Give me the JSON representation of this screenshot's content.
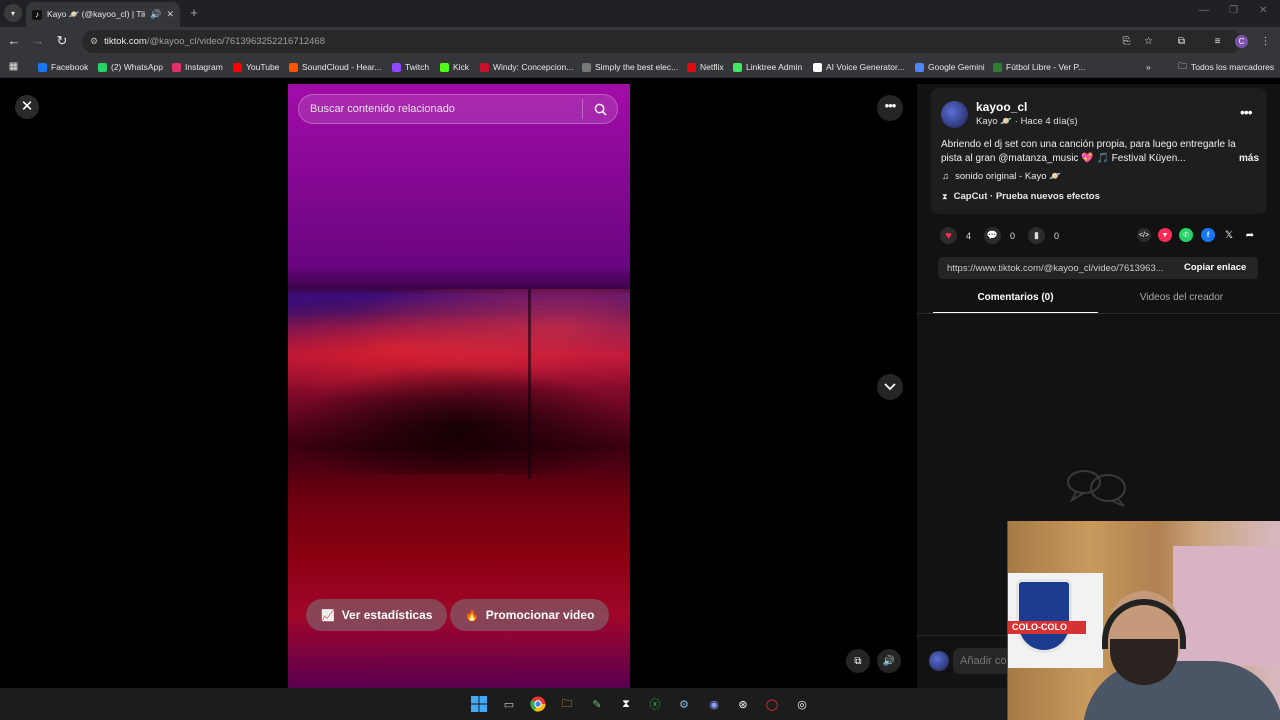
{
  "browser": {
    "tab": {
      "title": "Kayo 🪐 (@kayoo_cl) | TikTok",
      "favicon": "tiktok-icon"
    },
    "url": {
      "domain": "tiktok.com",
      "path": "/@kayoo_cl/video/7613963252216712468"
    },
    "profile_initial": "C",
    "bookmarks": [
      {
        "label": "Facebook",
        "icon": "facebook-icon",
        "color": "#1877f2"
      },
      {
        "label": "(2) WhatsApp",
        "icon": "whatsapp-icon",
        "color": "#25d366"
      },
      {
        "label": "Instagram",
        "icon": "instagram-icon",
        "color": "#e1306c"
      },
      {
        "label": "YouTube",
        "icon": "youtube-icon",
        "color": "#ff0000"
      },
      {
        "label": "SoundCloud - Hear...",
        "icon": "soundcloud-icon",
        "color": "#ff5500"
      },
      {
        "label": "Twitch",
        "icon": "twitch-icon",
        "color": "#9146ff"
      },
      {
        "label": "Kick",
        "icon": "kick-icon",
        "color": "#53fc18"
      },
      {
        "label": "Windy: Concepcion...",
        "icon": "windy-icon",
        "color": "#c8102e"
      },
      {
        "label": "Simply the best elec...",
        "icon": "headphones-icon",
        "color": "#777777"
      },
      {
        "label": "Netflix",
        "icon": "netflix-icon",
        "color": "#e50914"
      },
      {
        "label": "Linktree Admin",
        "icon": "linktree-icon",
        "color": "#43e660"
      },
      {
        "label": "AI Voice Generator...",
        "icon": "elevenlabs-icon",
        "color": "#ffffff"
      },
      {
        "label": "Google Gemini",
        "icon": "gemini-icon",
        "color": "#4e86f7"
      },
      {
        "label": "Fútbol Libre - Ver P...",
        "icon": "futbol-libre-icon",
        "color": "#2e7d32"
      }
    ],
    "all_bookmarks": "Todos los marcadores"
  },
  "video": {
    "search_placeholder": "Buscar contenido relacionado",
    "stats_button": "Ver estadísticas",
    "promote_button": "Promocionar video"
  },
  "creator": {
    "username": "kayoo_cl",
    "subline": "Kayo 🪐 · Hace 4 día(s)",
    "description": "Abriendo el dj set con una canción propia, para luego entregarle la pista al gran @matanza_music 💖 🎵 Festival Küyen...",
    "more": "más",
    "music": "sonido original - Kayo 🪐",
    "capcut": "CapCut · Prueba nuevos efectos"
  },
  "stats": {
    "likes": "4",
    "comments": "0",
    "saves": "0"
  },
  "share": {
    "url": "https://www.tiktok.com/@kayoo_cl/video/7613963...",
    "copy_label": "Copiar enlace"
  },
  "tabs": {
    "comments": "Comentarios (0)",
    "creator_videos": "Videos del creador"
  },
  "comment_placeholder": "Añadir co",
  "webcam": {
    "banner_text": "COLO-COLO"
  },
  "colors": {
    "accent": "#fe2c55",
    "whatsapp": "#25d366",
    "facebook": "#1877f2"
  }
}
